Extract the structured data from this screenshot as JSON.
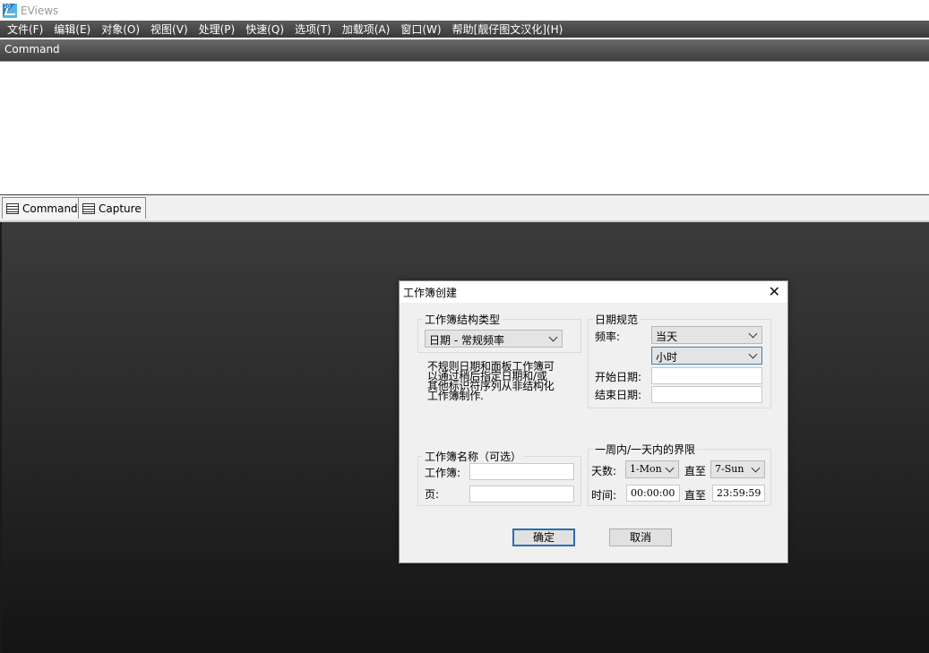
{
  "app": {
    "title": "EViews",
    "icon_text": "10"
  },
  "menu": [
    "文件(F)",
    "编辑(E)",
    "对象(O)",
    "视图(V)",
    "处理(P)",
    "快速(Q)",
    "选项(T)",
    "加载项(A)",
    "窗口(W)",
    "帮助[靓仔图文汉化](H)"
  ],
  "command_header": "Command",
  "tabs": [
    "Command",
    "Capture"
  ],
  "dialog": {
    "title": "工作簿创建",
    "structure": {
      "label": "工作簿结构类型",
      "selected": "日期 - 常规频率",
      "note": "不规则日期和面板工作簿可\n以通过稍后指定日期和/或\n其他标识符序列从非结构化\n工作簿制作."
    },
    "date_spec": {
      "label": "日期规范",
      "frequency_label": "频率:",
      "frequency": "当天",
      "sub_frequency": "小时",
      "start_label": "开始日期:",
      "start_value": "",
      "end_label": "结束日期:",
      "end_value": ""
    },
    "names": {
      "label": "工作簿名称（可选）",
      "workbook_label": "工作簿:",
      "workbook_value": "",
      "page_label": "页:",
      "page_value": ""
    },
    "bounds": {
      "label": "一周内/一天内的界限",
      "days_label": "天数:",
      "day_from": "1-Mon",
      "to_label": "直至",
      "day_to": "7-Sun",
      "time_label": "时间:",
      "time_from": "00:00:00",
      "time_to": "23:59:59"
    },
    "ok": "确定",
    "cancel": "取消"
  }
}
